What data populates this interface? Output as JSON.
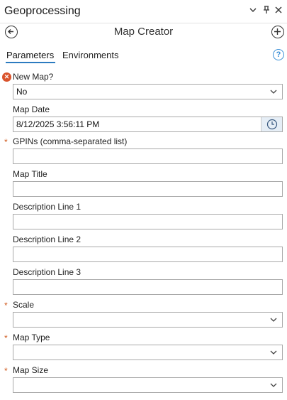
{
  "titlebar": {
    "title": "Geoprocessing",
    "icons": [
      "chevron-down-icon",
      "pin-icon",
      "close-icon"
    ]
  },
  "header": {
    "tool_title": "Map Creator"
  },
  "tabs": [
    {
      "label": "Parameters",
      "active": true
    },
    {
      "label": "Environments",
      "active": false
    }
  ],
  "colors": {
    "required": "#d05a1e",
    "error": "#d9532c",
    "accent": "#2c7bc0"
  },
  "params": [
    {
      "label": "New Map?",
      "value": "No",
      "type": "dropdown",
      "status": "error"
    },
    {
      "label": "Map Date",
      "value": "8/12/2025 3:56:11 PM",
      "type": "date",
      "status": "none"
    },
    {
      "label": "GPINs (comma-separated list)",
      "value": "",
      "type": "text",
      "status": "required"
    },
    {
      "label": "Map Title",
      "value": "",
      "type": "text",
      "status": "none"
    },
    {
      "label": "Description Line 1",
      "value": "",
      "type": "text",
      "status": "none"
    },
    {
      "label": "Description Line 2",
      "value": "",
      "type": "text",
      "status": "none"
    },
    {
      "label": "Description Line 3",
      "value": "",
      "type": "text",
      "status": "none"
    },
    {
      "label": "Scale",
      "value": "",
      "type": "dropdown",
      "status": "required"
    },
    {
      "label": "Map Type",
      "value": "",
      "type": "dropdown",
      "status": "required"
    },
    {
      "label": "Map Size",
      "value": "",
      "type": "dropdown",
      "status": "required"
    }
  ]
}
